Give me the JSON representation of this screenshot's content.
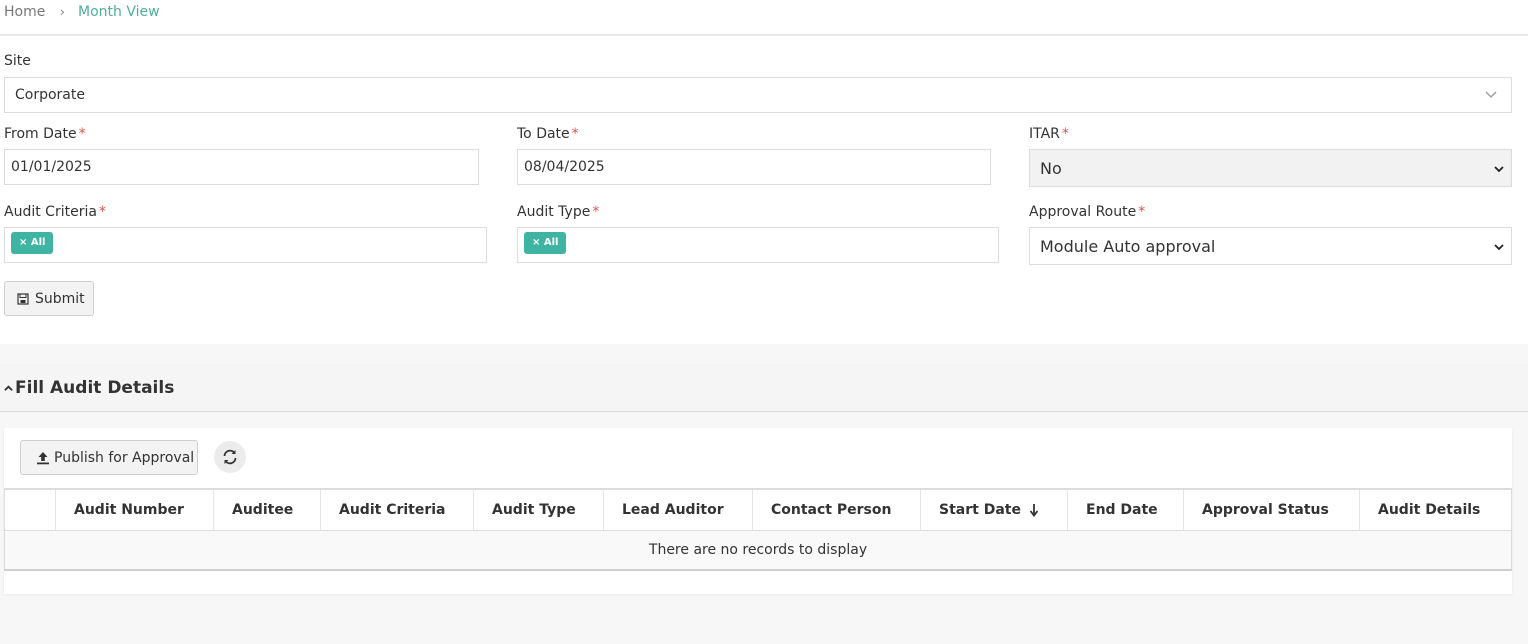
{
  "breadcrumb": {
    "home": "Home",
    "separator": "›",
    "current": "Month View"
  },
  "form": {
    "site": {
      "label": "Site",
      "value": "Corporate"
    },
    "from_date": {
      "label": "From Date",
      "value": "01/01/2025"
    },
    "to_date": {
      "label": "To Date",
      "value": "08/04/2025"
    },
    "itar": {
      "label": "ITAR",
      "value": "No"
    },
    "audit_criteria": {
      "label": "Audit Criteria",
      "tag": "× All"
    },
    "audit_type": {
      "label": "Audit Type",
      "tag": "× All"
    },
    "approval_route": {
      "label": "Approval Route",
      "value": "Module Auto approval"
    },
    "required_mark": "*",
    "submit_label": "Submit"
  },
  "section": {
    "title": "Fill Audit Details",
    "publish_label": "Publish for Approval",
    "table": {
      "columns": [
        "Audit Number",
        "Auditee",
        "Audit Criteria",
        "Audit Type",
        "Lead Auditor",
        "Contact Person",
        "Start Date",
        "End Date",
        "Approval Status",
        "Audit Details"
      ],
      "empty_text": "There are no records to display"
    }
  },
  "colors": {
    "accent": "#4fae9e",
    "tag": "#3fb4a2",
    "required": "#d9534f"
  }
}
